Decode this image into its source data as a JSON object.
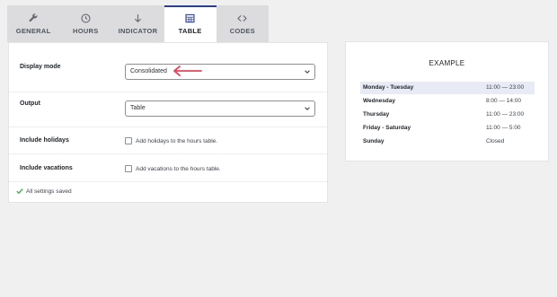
{
  "tabs": [
    {
      "label": "GENERAL",
      "icon": "wrench-icon"
    },
    {
      "label": "HOURS",
      "icon": "clock-icon"
    },
    {
      "label": "INDICATOR",
      "icon": "arrow-down-icon"
    },
    {
      "label": "TABLE",
      "icon": "table-icon",
      "active": true
    },
    {
      "label": "CODES",
      "icon": "code-icon"
    }
  ],
  "settings": {
    "display_mode": {
      "label": "Display mode",
      "value": "Consolidated"
    },
    "output": {
      "label": "Output",
      "value": "Table"
    },
    "include_holidays": {
      "label": "Include holidays",
      "checkbox_label": "Add holidays to the hours table.",
      "checked": false
    },
    "include_vacations": {
      "label": "Include vacations",
      "checkbox_label": "Add vacations to the hours table.",
      "checked": false
    },
    "status": "All settings saved"
  },
  "example": {
    "title": "EXAMPLE",
    "rows": [
      {
        "day": "Monday - Tuesday",
        "time": "11:00 — 23:00",
        "highlight": true
      },
      {
        "day": "Wednesday",
        "time": "8:00 — 14:00"
      },
      {
        "day": "Thursday",
        "time": "11:00 — 23:00"
      },
      {
        "day": "Friday - Saturday",
        "time": "11:00 — 5:00"
      },
      {
        "day": "Sunday",
        "time": "Closed"
      }
    ]
  },
  "colors": {
    "accent": "#2c3e8f",
    "annotation_arrow": "#e0475f",
    "success": "#46b450"
  }
}
